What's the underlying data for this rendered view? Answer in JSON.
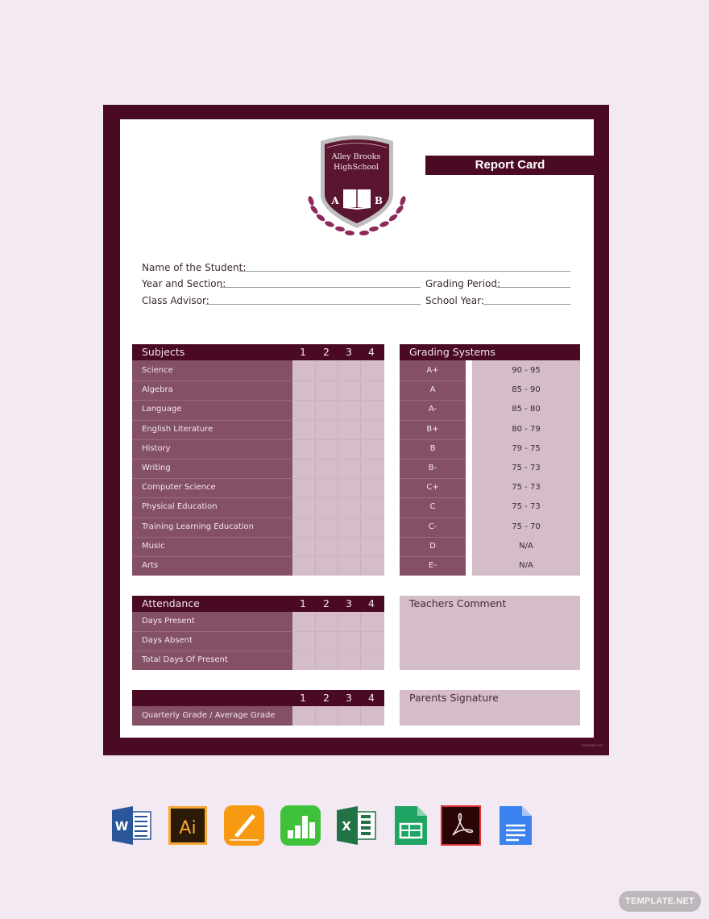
{
  "document": {
    "school_name_line1": "Alley Brooks",
    "school_name_line2": "HighSchool",
    "logo_letter_left": "A",
    "logo_letter_right": "B",
    "title": "Report Card",
    "fields": {
      "student_name": "Name of the Student:",
      "year_section": "Year and Section:",
      "grading_period": "Grading Period:",
      "class_advisor": "Class Advisor:",
      "school_year": "School Year:"
    },
    "subjects_table": {
      "header": "Subjects",
      "quarters": [
        "1",
        "2",
        "3",
        "4"
      ],
      "rows": [
        "Science",
        "Algebra",
        "Language",
        "English Literature",
        "History",
        "Writing",
        "Computer Science",
        "Physical Education",
        "Training Learning Education",
        "Music",
        "Arts"
      ]
    },
    "grading_systems": {
      "header": "Grading Systems",
      "rows": [
        {
          "grade": "A+",
          "range": "90 - 95"
        },
        {
          "grade": "A",
          "range": "85 - 90"
        },
        {
          "grade": "A-",
          "range": "85 - 80"
        },
        {
          "grade": "B+",
          "range": "80 - 79"
        },
        {
          "grade": "B",
          "range": "79 - 75"
        },
        {
          "grade": "B-",
          "range": "75 - 73"
        },
        {
          "grade": "C+",
          "range": "75 - 73"
        },
        {
          "grade": "C",
          "range": "75 - 73"
        },
        {
          "grade": "C-",
          "range": "75 - 70"
        },
        {
          "grade": "D",
          "range": "N/A"
        },
        {
          "grade": "E-",
          "range": "N/A"
        }
      ]
    },
    "attendance_table": {
      "header": "Attendance",
      "quarters": [
        "1",
        "2",
        "3",
        "4"
      ],
      "rows": [
        "Days Present",
        "Days Absent",
        "Total Days Of Present"
      ]
    },
    "average_table": {
      "header": "",
      "quarters": [
        "1",
        "2",
        "3",
        "4"
      ],
      "rows": [
        "Quarterly Grade / Average Grade"
      ]
    },
    "teachers_comment": "Teachers Comment",
    "parents_signature": "Parents Signature"
  },
  "colors": {
    "primary": "#4a0a24",
    "label_column": "#845065",
    "cell_fill": "#d4bcc8",
    "background": "#f3e9f3"
  },
  "format_icons": [
    {
      "name": "word-icon",
      "label": "W"
    },
    {
      "name": "illustrator-icon",
      "label": "Ai"
    },
    {
      "name": "pages-icon",
      "label": ""
    },
    {
      "name": "numbers-icon",
      "label": ""
    },
    {
      "name": "excel-icon",
      "label": "X"
    },
    {
      "name": "google-sheets-icon",
      "label": ""
    },
    {
      "name": "acrobat-icon",
      "label": ""
    },
    {
      "name": "google-docs-icon",
      "label": ""
    }
  ],
  "watermark": "TEMPLATE.NET"
}
